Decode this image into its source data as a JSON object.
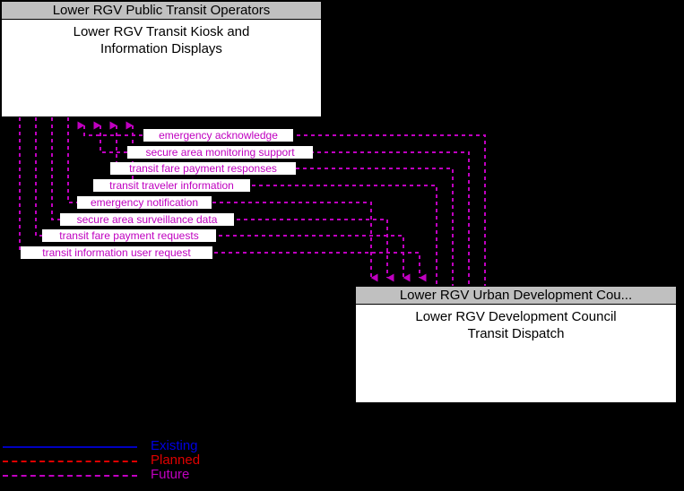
{
  "background_color": "#000000",
  "nodes": [
    {
      "id": "kiosk",
      "title": "Lower RGV Public Transit Operators",
      "body_line1": "Lower RGV Transit Kiosk and",
      "body_line2": "Information Displays",
      "title_bg": "#c0c0c0",
      "body_bg": "#ffffff"
    },
    {
      "id": "dispatch",
      "title": "Lower RGV Urban Development Cou...",
      "body_line1": "Lower RGV Development Council",
      "body_line2": "Transit Dispatch",
      "title_bg": "#c0c0c0",
      "body_bg": "#ffffff"
    }
  ],
  "flows": [
    {
      "label": "emergency acknowledge",
      "direction": "up",
      "status": "future",
      "color": "#c000c0"
    },
    {
      "label": "secure area monitoring support",
      "direction": "up",
      "status": "future",
      "color": "#c000c0"
    },
    {
      "label": "transit fare payment responses",
      "direction": "up",
      "status": "future",
      "color": "#c000c0"
    },
    {
      "label": "transit traveler information",
      "direction": "up",
      "status": "future",
      "color": "#c000c0"
    },
    {
      "label": "emergency notification",
      "direction": "down",
      "status": "future",
      "color": "#c000c0"
    },
    {
      "label": "secure area surveillance data",
      "direction": "down",
      "status": "future",
      "color": "#c000c0"
    },
    {
      "label": "transit fare payment requests",
      "direction": "down",
      "status": "future",
      "color": "#c000c0"
    },
    {
      "label": "transit information user request",
      "direction": "down",
      "status": "future",
      "color": "#c000c0"
    }
  ],
  "legend": {
    "items": [
      {
        "label": "Existing",
        "color": "#0000e0",
        "style": "solid"
      },
      {
        "label": "Planned",
        "color": "#e00000",
        "style": "dash-dot"
      },
      {
        "label": "Future",
        "color": "#c000c0",
        "style": "dashed"
      }
    ]
  }
}
